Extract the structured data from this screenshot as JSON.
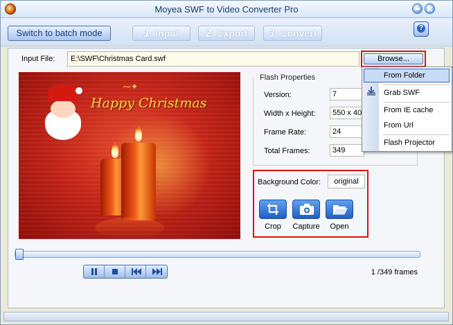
{
  "window": {
    "title": "Moyea SWF to Video Converter Pro"
  },
  "toolbar": {
    "batch_label": "Switch to batch mode",
    "steps": [
      {
        "num": "1",
        "label": "Input"
      },
      {
        "num": "2",
        "label": "Export"
      },
      {
        "num": "3",
        "label": "Convert"
      }
    ],
    "help_label": "?"
  },
  "input": {
    "label": "Input File:",
    "value": "E:\\SWF\\Christmas Card.swf",
    "browse_label": "Browse..."
  },
  "preview": {
    "greeting": "Happy Christmas"
  },
  "properties": {
    "title": "Flash Properties",
    "version_label": "Version:",
    "version_value": "7",
    "size_label": "Width x Height:",
    "size_value": "550 x 400",
    "rate_label": "Frame Rate:",
    "rate_value": "24",
    "frames_label": "Total Frames:",
    "frames_value": "349"
  },
  "background": {
    "label": "Background Color:",
    "value": "original"
  },
  "actions": {
    "crop": "Crop",
    "capture": "Capture",
    "open": "Open"
  },
  "playback": {
    "frames_text": "1 /349 frames",
    "position": 0.0
  },
  "menu": {
    "items": [
      "From Folder",
      "Grab SWF",
      "From IE cache",
      "From Url",
      "Flash Projector"
    ]
  },
  "colors": {
    "accent": "#3168c2",
    "highlight_border": "#e01010",
    "preview_red": "#c42518"
  }
}
